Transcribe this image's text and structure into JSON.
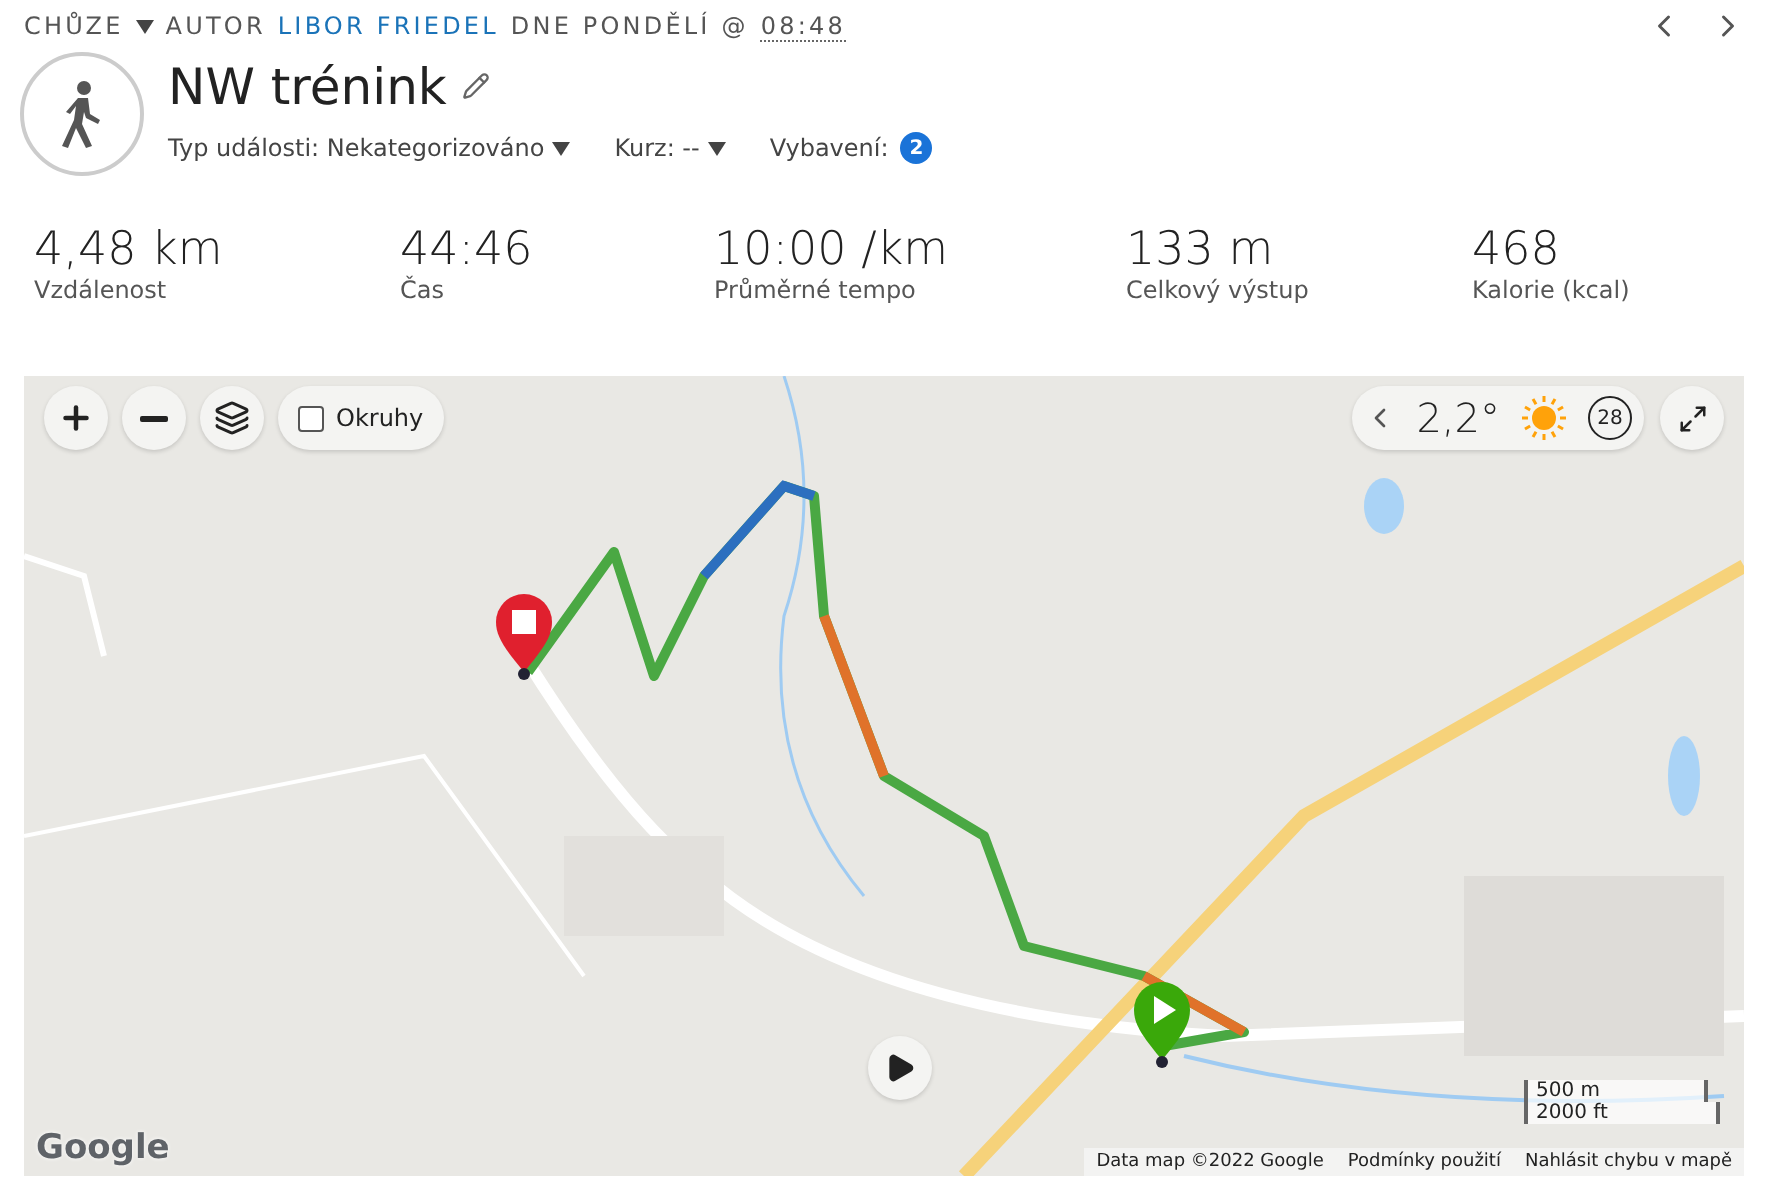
{
  "header": {
    "activity_type": "CHŮZE",
    "author_prefix": "AUTOR",
    "author": "LIBOR FRIEDEL",
    "date_text": "DNE PONDĚLÍ @",
    "time": "08:48"
  },
  "title": "NW trénink",
  "meta": [
    {
      "kind": "dropdown",
      "label": "Typ události: Nekategorizováno"
    },
    {
      "kind": "dropdown",
      "label": "Kurz: --"
    },
    {
      "kind": "count",
      "label": "Vybavení:",
      "count": "2"
    }
  ],
  "stats": [
    {
      "value": "4,48 km",
      "label": "Vzdálenost"
    },
    {
      "value": "44:46",
      "label": "Čas"
    },
    {
      "value": "10:00 /km",
      "label": "Průměrné tempo"
    },
    {
      "value": "133 m",
      "label": "Celkový výstup"
    },
    {
      "value": "468",
      "label": "Kalorie (kcal)"
    }
  ],
  "map": {
    "laps": {
      "label": "Okruhy",
      "checked": false
    },
    "weather": {
      "temperature": "2,2°",
      "wind": "28"
    },
    "logo": "Google",
    "scale": [
      "500 m",
      "2000 ft"
    ],
    "footer_links": [
      "Data map ©2022 Google",
      "Podmínky použití",
      "Nahlásit chybu v mapě"
    ]
  }
}
